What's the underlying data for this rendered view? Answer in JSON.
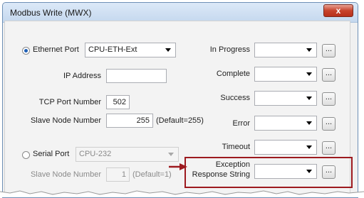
{
  "window": {
    "title": "Modbus Write (MWX)",
    "close_glyph": "x"
  },
  "left": {
    "ethernet_port_label": "Ethernet Port",
    "ethernet_port_value": "CPU-ETH-Ext",
    "ip_address_label": "IP Address",
    "ip_address_value": "",
    "tcp_port_label": "TCP Port Number",
    "tcp_port_value": "502",
    "slave_node_label": "Slave Node Number",
    "slave_node_value": "255",
    "slave_node_default": "(Default=255)",
    "serial_port_label": "Serial Port",
    "serial_port_value": "CPU-232",
    "serial_slave_node_label": "Slave Node Number",
    "serial_slave_node_value": "1",
    "serial_slave_node_default": "(Default=1)"
  },
  "right": {
    "in_progress_label": "In Progress",
    "complete_label": "Complete",
    "success_label": "Success",
    "error_label": "Error",
    "timeout_label": "Timeout",
    "exception_label_line1": "Exception",
    "exception_label_line2": "Response String",
    "browse_label": "..."
  },
  "colors": {
    "highlight": "#9d1a1f",
    "radio_selected": "#1f5fb4"
  }
}
